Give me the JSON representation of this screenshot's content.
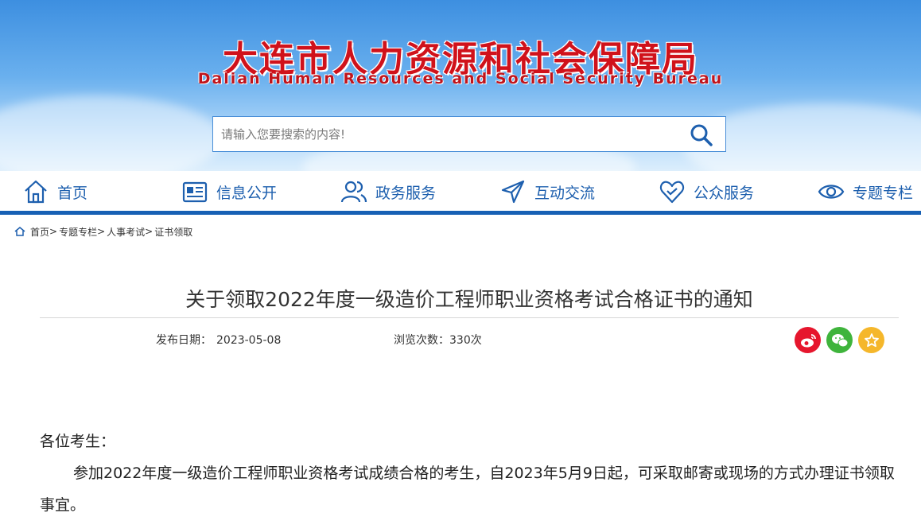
{
  "header": {
    "title": "大连市人力资源和社会保障局",
    "subtitle": "Dalian Human Resources and Social Security Bureau"
  },
  "search": {
    "placeholder": "请输入您要搜索的内容!",
    "icon": "search-icon"
  },
  "nav": {
    "items": [
      {
        "label": "首页",
        "icon": "home-icon"
      },
      {
        "label": "信息公开",
        "icon": "newspaper-icon"
      },
      {
        "label": "政务服务",
        "icon": "users-icon"
      },
      {
        "label": "互动交流",
        "icon": "send-icon"
      },
      {
        "label": "公众服务",
        "icon": "heart-icon"
      },
      {
        "label": "专题专栏",
        "icon": "eye-icon"
      }
    ],
    "color": "#1760b4"
  },
  "breadcrumb": {
    "items": [
      "首页",
      "专题专栏",
      "人事考试",
      "证书领取"
    ],
    "separator": ">"
  },
  "article": {
    "title": "关于领取2022年度一级造价工程师职业资格考试合格证书的通知",
    "date_label": "发布日期：",
    "date": "2023-05-08",
    "views_label": "浏览次数：",
    "views": "330次",
    "share": [
      {
        "name": "weibo-share",
        "icon": "weibo-icon",
        "color": "#e6162d"
      },
      {
        "name": "wechat-share",
        "icon": "wechat-icon",
        "color": "#3fb43c"
      },
      {
        "name": "favorite-share",
        "icon": "star-icon",
        "color": "#f5b72b"
      }
    ],
    "greeting": "各位考生：",
    "paragraph": "参加2022年度一级造价工程师职业资格考试成绩合格的考生，自2023年5月9日起，可采取邮寄或现场的方式办理证书领取事宜。"
  },
  "colors": {
    "title_red": "#d0121b",
    "nav_blue": "#1d5fae"
  }
}
